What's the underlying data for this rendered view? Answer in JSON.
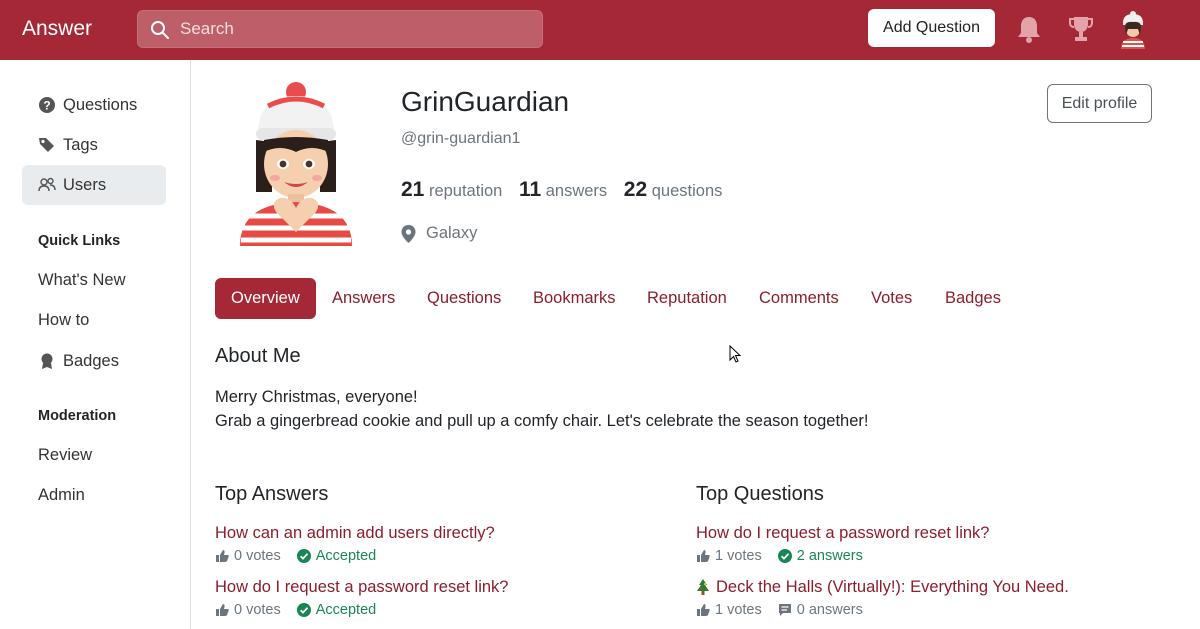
{
  "header": {
    "brand": "Answer",
    "search_placeholder": "Search",
    "add_question_label": "Add Question"
  },
  "sidebar": {
    "items": [
      {
        "label": "Questions",
        "icon": "question-circle-icon"
      },
      {
        "label": "Tags",
        "icon": "tags-icon"
      },
      {
        "label": "Users",
        "icon": "people-icon",
        "active": true
      }
    ],
    "quick_links_heading": "Quick Links",
    "quick_links": [
      {
        "label": "What's New"
      },
      {
        "label": "How to"
      },
      {
        "label": "Badges",
        "icon": "award-icon"
      }
    ],
    "moderation_heading": "Moderation",
    "moderation": [
      {
        "label": "Review"
      },
      {
        "label": "Admin"
      }
    ]
  },
  "profile": {
    "display_name": "GrinGuardian",
    "username": "@grin-guardian1",
    "reputation_value": "21",
    "reputation_label": "reputation",
    "answers_value": "11",
    "answers_label": "answers",
    "questions_value": "22",
    "questions_label": "questions",
    "location": "Galaxy",
    "edit_label": "Edit profile"
  },
  "tabs": [
    "Overview",
    "Answers",
    "Questions",
    "Bookmarks",
    "Reputation",
    "Comments",
    "Votes",
    "Badges"
  ],
  "active_tab": "Overview",
  "about": {
    "title": "About Me",
    "line1": "Merry Christmas, everyone!",
    "line2": "Grab a gingerbread cookie and pull up a comfy chair. Let's celebrate the season together!"
  },
  "top_answers": {
    "title": "Top Answers",
    "items": [
      {
        "title": "How can an admin add users directly?",
        "votes": "0 votes",
        "status": "Accepted"
      },
      {
        "title": "How do I request a password reset link?",
        "votes": "0 votes",
        "status": "Accepted"
      }
    ]
  },
  "top_questions": {
    "title": "Top Questions",
    "items": [
      {
        "title": "How do I request a password reset link?",
        "votes": "1 votes",
        "answers": "2 answers",
        "answered": true
      },
      {
        "title": "Deck the Halls (Virtually!): Everything You Need.",
        "prefix_icon": "christmas-tree-icon",
        "votes": "1 votes",
        "answers": "0 answers",
        "answered": false
      }
    ]
  },
  "colors": {
    "brand": "#a52836",
    "link": "#8b1e2c",
    "success": "#198754"
  }
}
